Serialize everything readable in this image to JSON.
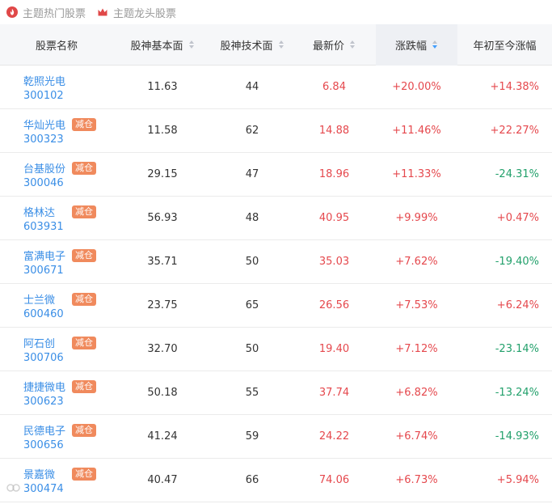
{
  "tabs": [
    {
      "label": "主题热门股票",
      "icon": "flame-icon"
    },
    {
      "label": "主题龙头股票",
      "icon": "crown-icon"
    }
  ],
  "colors": {
    "up": "#e5484d",
    "down": "#22a06b",
    "link": "#3a8ee6",
    "badge": "#f08a5d"
  },
  "table": {
    "headers": [
      {
        "label": "股票名称",
        "sortable": false
      },
      {
        "label": "股神基本面",
        "sortable": true
      },
      {
        "label": "股神技术面",
        "sortable": true
      },
      {
        "label": "最新价",
        "sortable": true
      },
      {
        "label": "涨跌幅",
        "sortable": true,
        "active": true,
        "order": "desc"
      },
      {
        "label": "年初至今涨幅",
        "sortable": false
      }
    ],
    "rows": [
      {
        "name": "乾照光电",
        "code": "300102",
        "badge": "",
        "fundamental": "11.63",
        "technical": "44",
        "price": "6.84",
        "change": "+20.00%",
        "ytd": "+14.38%"
      },
      {
        "name": "华灿光电",
        "code": "300323",
        "badge": "减仓",
        "fundamental": "11.58",
        "technical": "62",
        "price": "14.88",
        "change": "+11.46%",
        "ytd": "+22.27%"
      },
      {
        "name": "台基股份",
        "code": "300046",
        "badge": "减仓",
        "fundamental": "29.15",
        "technical": "47",
        "price": "18.96",
        "change": "+11.33%",
        "ytd": "-24.31%"
      },
      {
        "name": "格林达",
        "code": "603931",
        "badge": "减仓",
        "fundamental": "56.93",
        "technical": "48",
        "price": "40.95",
        "change": "+9.99%",
        "ytd": "+0.47%"
      },
      {
        "name": "富满电子",
        "code": "300671",
        "badge": "减仓",
        "fundamental": "35.71",
        "technical": "50",
        "price": "35.03",
        "change": "+7.62%",
        "ytd": "-19.40%"
      },
      {
        "name": "士兰微",
        "code": "600460",
        "badge": "减仓",
        "fundamental": "23.75",
        "technical": "65",
        "price": "26.56",
        "change": "+7.53%",
        "ytd": "+6.24%"
      },
      {
        "name": "阿石创",
        "code": "300706",
        "badge": "减仓",
        "fundamental": "32.70",
        "technical": "50",
        "price": "19.40",
        "change": "+7.12%",
        "ytd": "-23.14%"
      },
      {
        "name": "捷捷微电",
        "code": "300623",
        "badge": "减仓",
        "fundamental": "50.18",
        "technical": "55",
        "price": "37.74",
        "change": "+6.82%",
        "ytd": "-13.24%"
      },
      {
        "name": "民德电子",
        "code": "300656",
        "badge": "减仓",
        "fundamental": "41.24",
        "technical": "59",
        "price": "24.22",
        "change": "+6.74%",
        "ytd": "-14.93%"
      },
      {
        "name": "景嘉微",
        "code": "300474",
        "badge": "减仓",
        "fundamental": "40.47",
        "technical": "66",
        "price": "74.06",
        "change": "+6.73%",
        "ytd": "+5.94%"
      }
    ]
  }
}
